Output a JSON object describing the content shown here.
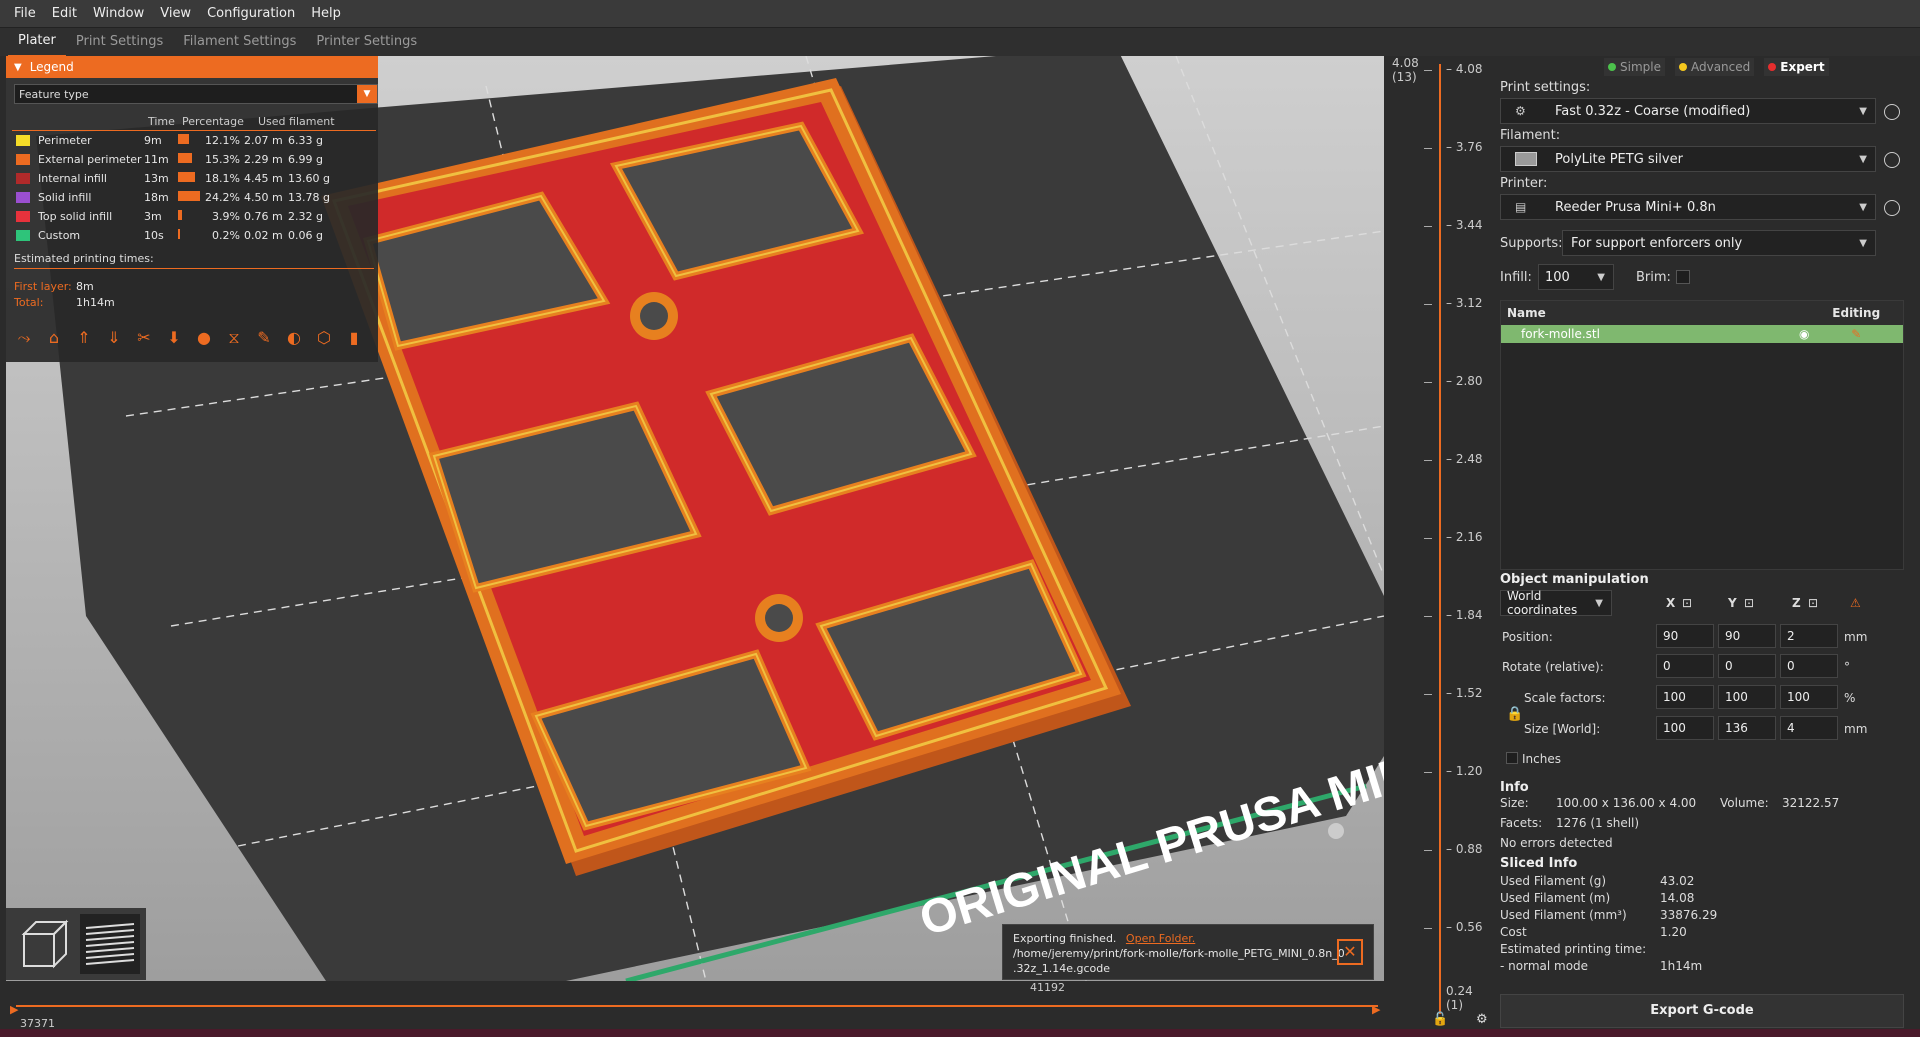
{
  "menu": [
    "File",
    "Edit",
    "Window",
    "View",
    "Configuration",
    "Help"
  ],
  "tabs": [
    "Plater",
    "Print Settings",
    "Filament Settings",
    "Printer Settings"
  ],
  "legend": {
    "title": "Legend",
    "select_value": "Feature type",
    "headers": {
      "time": "Time",
      "percentage": "Percentage",
      "used": "Used filament"
    },
    "rows": [
      {
        "name": "Perimeter",
        "time": "9m",
        "pct": "12.1%",
        "len": "2.07 m",
        "g": "6.33 g",
        "color": "#f5dc28",
        "bar": 0.5
      },
      {
        "name": "External perimeter",
        "time": "11m",
        "pct": "15.3%",
        "len": "2.29 m",
        "g": "6.99 g",
        "color": "#ed6b21",
        "bar": 0.63
      },
      {
        "name": "Internal infill",
        "time": "13m",
        "pct": "18.1%",
        "len": "4.45 m",
        "g": "13.60 g",
        "color": "#b02a2a",
        "bar": 0.75
      },
      {
        "name": "Solid infill",
        "time": "18m",
        "pct": "24.2%",
        "len": "4.50 m",
        "g": "13.78 g",
        "color": "#9a4fd0",
        "bar": 1.0
      },
      {
        "name": "Top solid infill",
        "time": "3m",
        "pct": "3.9%",
        "len": "0.76 m",
        "g": "2.32 g",
        "color": "#e8323c",
        "bar": 0.16
      },
      {
        "name": "Custom",
        "time": "10s",
        "pct": "0.2%",
        "len": "0.02 m",
        "g": "0.06 g",
        "color": "#2ec47a",
        "bar": 0.03
      }
    ],
    "est_title": "Estimated printing times:",
    "first_layer_label": "First layer:",
    "first_layer": "8m",
    "total_label": "Total:",
    "total": "1h14m"
  },
  "viewport": {
    "bed_text": "ORIGINAL PRUSA MINI",
    "notification": {
      "message": "Exporting finished.",
      "link": "Open Folder.",
      "path1": "/home/jeremy/print/fork-molle/fork-molle_PETG_MINI_0.8n_0",
      "path2": ".32z_1.14e.gcode"
    }
  },
  "hslider": {
    "left_value": "37371",
    "right_value": "41192"
  },
  "vslider": {
    "top_value": "4.08",
    "top_layer": "(13)",
    "ticks": [
      "4.08",
      "3.76",
      "3.44",
      "3.12",
      "2.80",
      "2.48",
      "2.16",
      "1.84",
      "1.52",
      "1.20",
      "0.88",
      "0.56"
    ],
    "bottom_value": "0.24",
    "bottom_layer": "(1)"
  },
  "right": {
    "modes": [
      {
        "label": "Simple",
        "color": "#4cc24c"
      },
      {
        "label": "Advanced",
        "color": "#f5c81e"
      },
      {
        "label": "Expert",
        "color": "#e62e2e"
      }
    ],
    "print_label": "Print settings:",
    "print_value": "Fast 0.32z - Coarse (modified)",
    "filament_label": "Filament:",
    "filament_value": "PolyLite PETG silver",
    "printer_label": "Printer:",
    "printer_value": "Reeder Prusa Mini+ 0.8n",
    "supports_label": "Supports:",
    "supports_value": "For support enforcers only",
    "infill_label": "Infill:",
    "infill_value": "100",
    "brim_label": "Brim:",
    "list_headers": {
      "name": "Name",
      "editing": "Editing"
    },
    "object_name": "fork-molle.stl",
    "om_title": "Object manipulation",
    "coord_value": "World coordinates",
    "axes": [
      "X",
      "Y",
      "Z"
    ],
    "position_label": "Position:",
    "position": [
      "90",
      "90",
      "2"
    ],
    "position_unit": "mm",
    "rotate_label": "Rotate (relative):",
    "rotate": [
      "0",
      "0",
      "0"
    ],
    "rotate_unit": "°",
    "scale_label": "Scale factors:",
    "scale": [
      "100",
      "100",
      "100"
    ],
    "scale_unit": "%",
    "size_label": "Size [World]:",
    "size": [
      "100",
      "136",
      "4"
    ],
    "size_unit": "mm",
    "inches_label": "Inches",
    "info_title": "Info",
    "info_size_label": "Size:",
    "info_size": "100.00 x 136.00 x 4.00",
    "info_volume_label": "Volume:",
    "info_volume": "32122.57",
    "info_facets_label": "Facets:",
    "info_facets": "1276 (1 shell)",
    "info_errors": "No errors detected",
    "sliced_title": "Sliced Info",
    "sliced": [
      {
        "k": "Used Filament (g)",
        "v": "43.02"
      },
      {
        "k": "Used Filament (m)",
        "v": "14.08"
      },
      {
        "k": "Used Filament (mm³)",
        "v": "33876.29"
      },
      {
        "k": "Cost",
        "v": "1.20"
      },
      {
        "k": "Estimated printing time:",
        "v": ""
      },
      {
        "k": "- normal mode",
        "v": "1h14m"
      }
    ],
    "export_label": "Export G-code"
  }
}
